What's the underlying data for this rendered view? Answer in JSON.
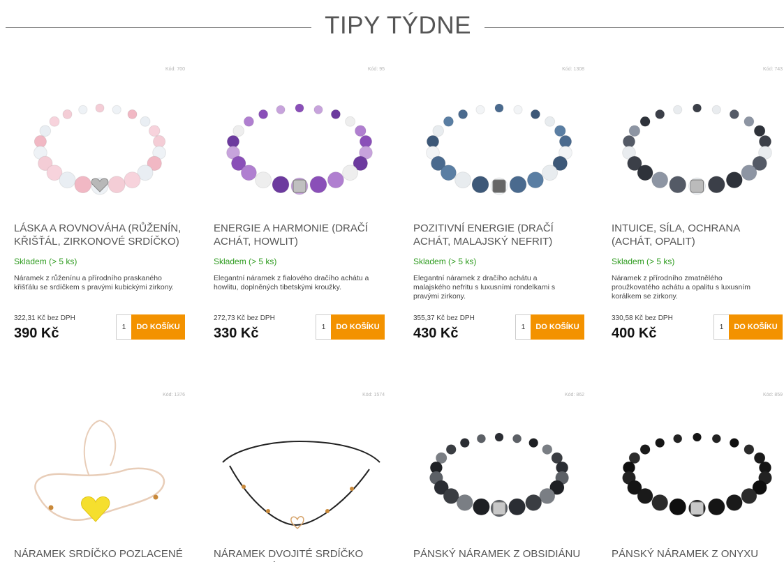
{
  "section": {
    "title": "TIPY TÝDNE"
  },
  "products": [
    {
      "code": "Kód: 700",
      "title": "LÁSKA A ROVNOVÁHA (RŮŽENÍN, KŘIŠŤÁL, ZIRKONOVÉ SRDÍČKO)",
      "stock": "Skladem (> 5 ks)",
      "description": "Náramek z růženínu a přírodního praskaného křišťálu se srdíčkem s pravými kubickými zirkony.",
      "net_price": "322,31 Kč bez DPH",
      "price": "390 Kč",
      "qty": "1",
      "buy_label": "DO KOŠÍKU",
      "image": "rose-quartz-bracelet"
    },
    {
      "code": "Kód: 95",
      "title": "ENERGIE A HARMONIE (DRAČÍ ACHÁT, HOWLIT)",
      "stock": "Skladem (> 5 ks)",
      "description": "Elegantní náramek z fialového dračího achátu a howlitu, doplněných tibetskými kroužky.",
      "net_price": "272,73 Kč bez DPH",
      "price": "330 Kč",
      "qty": "1",
      "buy_label": "DO KOŠÍKU",
      "image": "purple-agate-bracelet"
    },
    {
      "code": "Kód: 1308",
      "title": "POZITIVNÍ ENERGIE (DRAČÍ ACHÁT, MALAJSKÝ NEFRIT)",
      "stock": "Skladem (> 5 ks)",
      "description": "Elegantní náramek z dračího achátu a malajského nefritu s luxusními rondelkami s pravými zirkony.",
      "net_price": "355,37 Kč bez DPH",
      "price": "430 Kč",
      "qty": "1",
      "buy_label": "DO KOŠÍKU",
      "image": "blue-agate-bracelet"
    },
    {
      "code": "Kód: 743",
      "title": "INTUICE, SÍLA, OCHRANA (ACHÁT, OPALIT)",
      "stock": "Skladem (> 5 ks)",
      "description": "Náramek z přírodního zmatnělého proužkovatého achátu a opalitu s luxusním korálkem se zirkony.",
      "net_price": "330,58 Kč bez DPH",
      "price": "400 Kč",
      "qty": "1",
      "buy_label": "DO KOŠÍKU",
      "image": "striped-agate-bracelet"
    },
    {
      "code": "Kód: 1376",
      "title": "NÁRAMEK SRDÍČKO POZLACENÉ",
      "image": "heart-string-bracelet"
    },
    {
      "code": "Kód: 1574",
      "title": "NÁRAMEK DVOJITÉ SRDÍČKO POZLACENÉ",
      "image": "double-heart-bracelet"
    },
    {
      "code": "Kód: 862",
      "title": "PÁNSKÝ NÁRAMEK Z OBSIDIÁNU",
      "image": "obsidian-bracelet"
    },
    {
      "code": "Kód: 859",
      "title": "PÁNSKÝ NÁRAMEK Z ONYXU",
      "image": "onyx-bracelet"
    }
  ]
}
